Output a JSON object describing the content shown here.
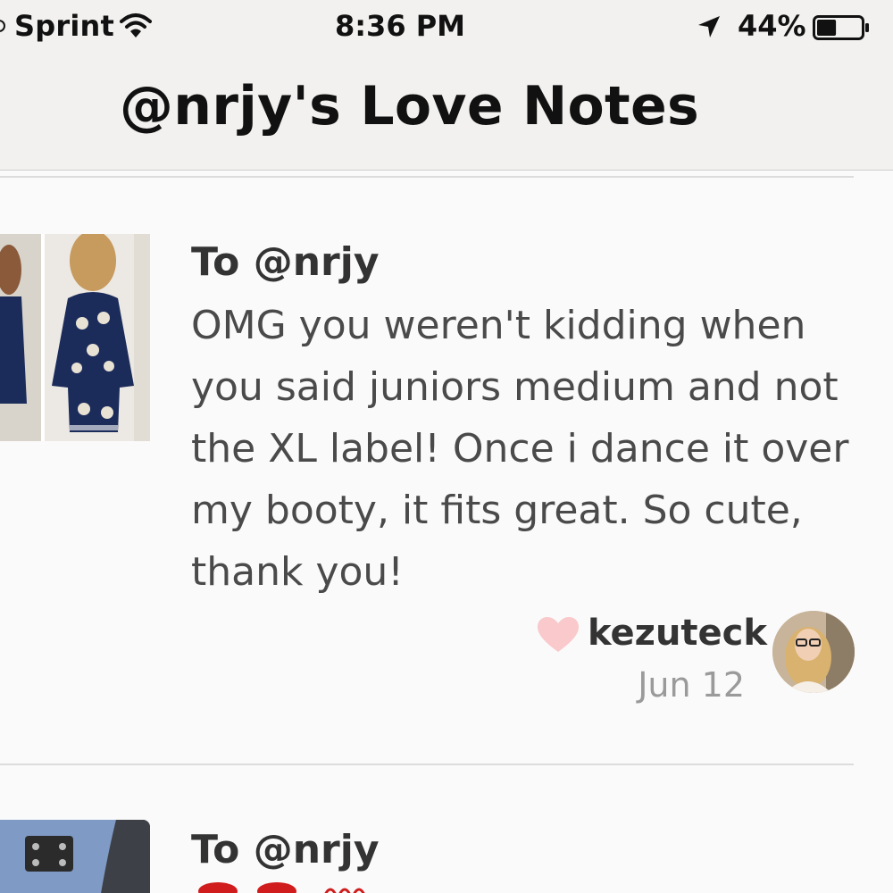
{
  "status_bar": {
    "carrier": "Sprint",
    "time": "8:36 PM",
    "battery_percent": "44%",
    "battery_level": 0.44,
    "icons": [
      "signal-icon",
      "wifi-icon",
      "location-arrow-icon",
      "battery-icon"
    ]
  },
  "header": {
    "title": "@nrjy's Love Notes"
  },
  "notes": [
    {
      "to": "To @nrjy",
      "message": "OMG you weren't kidding when you said juniors medium and not the XL label! Once i dance it over my booty, it fits great. So cute, thank you!",
      "sender": "kezuteck",
      "date": "Jun 12",
      "heart_color": "#f9c9cc"
    },
    {
      "to": "To @nrjy"
    }
  ],
  "colors": {
    "header_bg": "#f2f1ef",
    "page_bg": "#fbfafa",
    "text_primary": "#333333",
    "text_message": "#4a4a4a",
    "text_muted": "#9a9a9a"
  }
}
